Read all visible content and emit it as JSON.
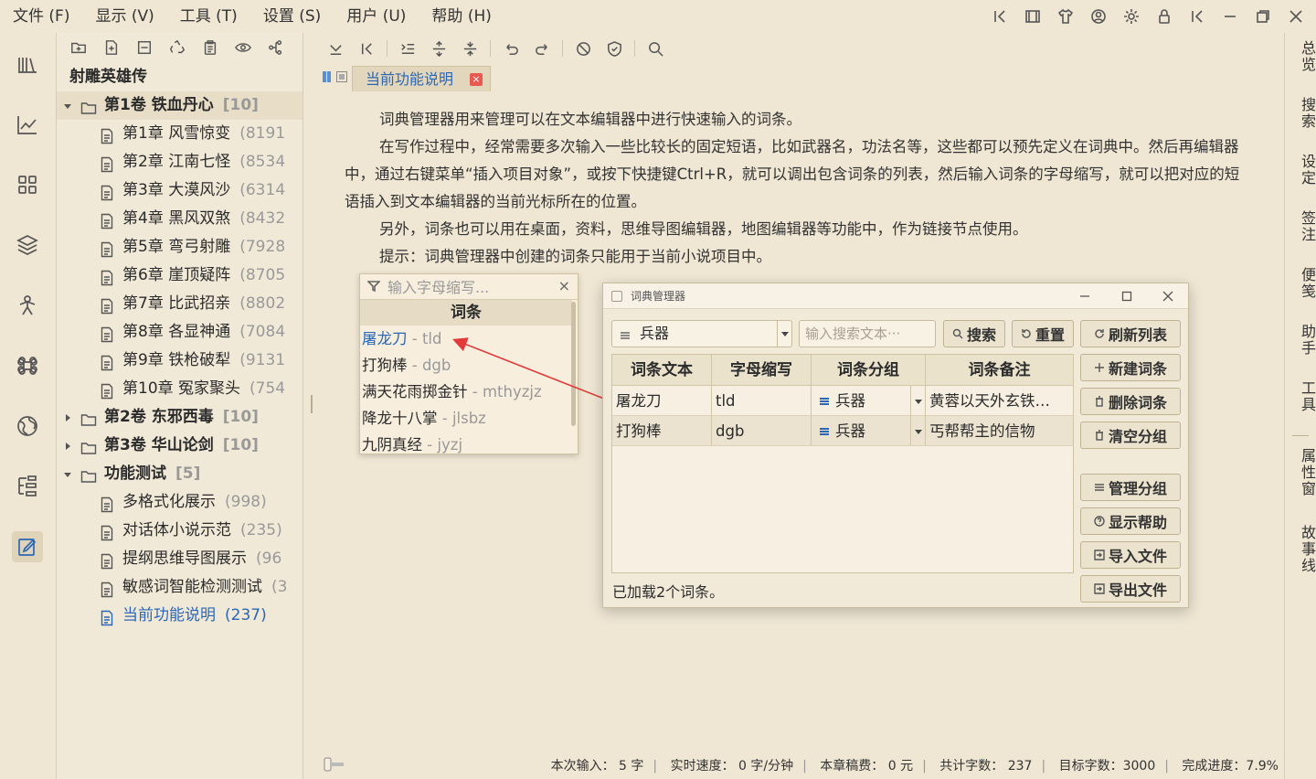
{
  "menu": [
    {
      "label": "文件 (F)"
    },
    {
      "label": "显示 (V)"
    },
    {
      "label": "工具 (T)"
    },
    {
      "label": "设置 (S)"
    },
    {
      "label": "用户 (U)"
    },
    {
      "label": "帮助 (H)"
    }
  ],
  "project": {
    "title": "射雕英雄传",
    "volumes": [
      {
        "label": "第1卷 铁血丹心",
        "count": "[10]",
        "expanded": true,
        "chapters": [
          {
            "label": "第1章 风雪惊变",
            "count": "(8191"
          },
          {
            "label": "第2章 江南七怪",
            "count": "(8534"
          },
          {
            "label": "第3章 大漠风沙",
            "count": "(6314"
          },
          {
            "label": "第4章 黑风双煞",
            "count": "(8432"
          },
          {
            "label": "第5章 弯弓射雕",
            "count": "(7928"
          },
          {
            "label": "第6章 崖顶疑阵",
            "count": "(8705"
          },
          {
            "label": "第7章 比武招亲",
            "count": "(8802"
          },
          {
            "label": "第8章 各显神通",
            "count": "(7084"
          },
          {
            "label": "第9章 铁枪破犁",
            "count": "(9131"
          },
          {
            "label": "第10章 冤家聚头",
            "count": "(754"
          }
        ]
      },
      {
        "label": "第2卷 东邪西毒",
        "count": "[10]",
        "expanded": false,
        "chapters": []
      },
      {
        "label": "第3卷 华山论剑",
        "count": "[10]",
        "expanded": false,
        "chapters": []
      },
      {
        "label": "功能测试",
        "count": "[5]",
        "expanded": true,
        "chapters": [
          {
            "label": "多格式化展示",
            "count": "(998)"
          },
          {
            "label": "对话体小说示范",
            "count": "(235)"
          },
          {
            "label": "提纲思维导图展示",
            "count": "(96"
          },
          {
            "label": "敏感词智能检测测试",
            "count": "(3"
          },
          {
            "label": "当前功能说明",
            "count": "(237)",
            "selected": true
          }
        ]
      }
    ]
  },
  "editor": {
    "tab_title": "当前功能说明",
    "tab_close": "×",
    "paragraphs": [
      "词典管理器用来管理可以在文本编辑器中进行快速输入的词条。",
      "在写作过程中，经常需要多次输入一些比较长的固定短语，比如武器名，功法名等，这些都可以预先定义在词典中。然后再编辑器中，通过右键菜单“插入项目对象”，或按下快捷键Ctrl+R，就可以调出包含词条的列表，然后输入词条的字母缩写，就可以把对应的短语插入到文本编辑器的当前光标所在的位置。",
      "另外，词条也可以用在桌面，资料，思维导图编辑器，地图编辑器等功能中，作为链接节点使用。",
      "提示：词典管理器中创建的词条只能用于当前小说项目中。"
    ]
  },
  "autocomplete": {
    "placeholder": "输入字母缩写...",
    "close": "×",
    "header": "词条",
    "items": [
      {
        "word": "屠龙刀",
        "abbr": " - tld",
        "selected": true
      },
      {
        "word": "打狗棒",
        "abbr": " - dgb"
      },
      {
        "word": "满天花雨掷金针",
        "abbr": " - mthyzjz"
      },
      {
        "word": "降龙十八掌",
        "abbr": " - jlsbz"
      },
      {
        "word": "九阴真经",
        "abbr": " - jyzj"
      }
    ]
  },
  "dialog": {
    "title": "词典管理器",
    "group_select": "兵器",
    "search_placeholder": "输入搜索文本···",
    "search_btn": "搜索",
    "reset_btn": "重置",
    "actions": {
      "refresh": "刷新列表",
      "new": "新建词条",
      "delete": "删除词条",
      "clear": "清空分组",
      "manage": "管理分组",
      "help": "显示帮助",
      "import": "导入文件",
      "export": "导出文件"
    },
    "columns": [
      "词条文本",
      "字母缩写",
      "词条分组",
      "词条备注"
    ],
    "rows": [
      {
        "text": "屠龙刀",
        "abbr": "tld",
        "group": "兵器",
        "note": "黄蓉以天外玄铁…"
      },
      {
        "text": "打狗棒",
        "abbr": "dgb",
        "group": "兵器",
        "note": "丐帮帮主的信物"
      }
    ],
    "status": "已加载2个词条。"
  },
  "right_rail": [
    "总览",
    "搜索",
    "设定",
    "签注",
    "便笺",
    "助手",
    "工具",
    "属性窗",
    "故事线"
  ],
  "statusbar": {
    "input": "本次输入： 5 字",
    "speed": "实时速度： 0 字/分钟",
    "fee": "本章稿费： 0 元",
    "total": "共计字数： 237",
    "target": "目标字数：3000",
    "progress": "完成进度：7.9%"
  },
  "colors": {
    "background": "#efe6d3",
    "accent": "#2b67b5",
    "tab_close": "#e85a4f",
    "arrow": "#e23b3b"
  }
}
